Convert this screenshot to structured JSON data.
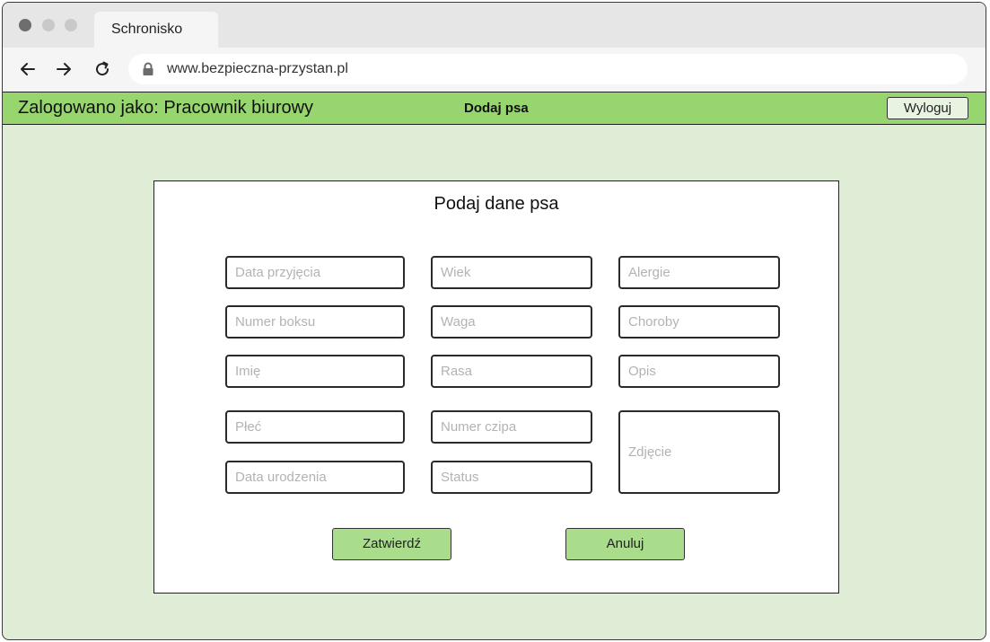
{
  "browser": {
    "tab_title": "Schronisko",
    "url": "www.bezpieczna-przystan.pl"
  },
  "appbar": {
    "logged_in_label": "Zalogowano jako: Pracownik biurowy",
    "page_title": "Dodaj psa",
    "logout_label": "Wyloguj"
  },
  "form": {
    "title": "Podaj dane psa",
    "fields": {
      "admission_date": "Data przyjęcia",
      "age": "Wiek",
      "allergies": "Alergie",
      "box_number": "Numer boksu",
      "weight": "Waga",
      "diseases": "Choroby",
      "name": "Imię",
      "breed": "Rasa",
      "description": "Opis",
      "sex": "Płeć",
      "chip_number": "Numer czipa",
      "photo": "Zdjęcie",
      "birth_date": "Data urodzenia",
      "status": "Status"
    },
    "submit_label": "Zatwierdź",
    "cancel_label": "Anuluj"
  },
  "colors": {
    "appbar": "#97d56f",
    "page_background": "#dfecd6",
    "button": "#a9dd8c"
  },
  "icons": {
    "back": "arrow-left",
    "forward": "arrow-right",
    "reload": "reload",
    "lock": "lock"
  }
}
